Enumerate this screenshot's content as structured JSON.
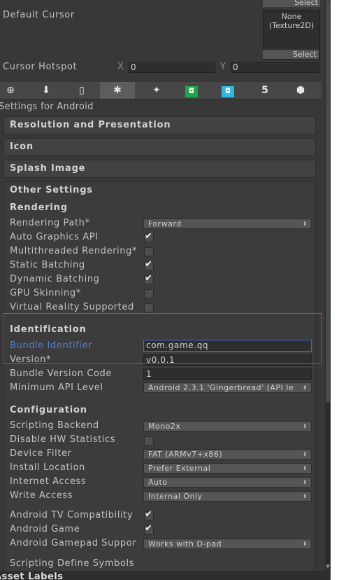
{
  "cursor": {
    "top_select": "Select",
    "default_label": "Default Cursor",
    "texture_text": "None\n(Texture2D)",
    "select": "Select",
    "hotspot_label": "Cursor Hotspot",
    "x_label": "X",
    "x_value": "0",
    "y_label": "Y",
    "y_value": "0"
  },
  "platform_tabs": [
    {
      "icon": "globe-icon",
      "glyph": "⊕"
    },
    {
      "icon": "download-icon",
      "glyph": "⬇"
    },
    {
      "icon": "phone-icon",
      "glyph": "▯"
    },
    {
      "icon": "android-icon",
      "glyph": "✱"
    },
    {
      "icon": "blackberry-icon",
      "glyph": "✦"
    },
    {
      "icon": "samsung-tv-icon",
      "glyph": "◘"
    },
    {
      "icon": "tizen-icon",
      "glyph": "◘"
    },
    {
      "icon": "html5-icon",
      "glyph": "5"
    },
    {
      "icon": "cube-icon",
      "glyph": "⬢"
    }
  ],
  "settings_for": "Settings for Android",
  "sections": {
    "resolution": "Resolution and Presentation",
    "icon": "Icon",
    "splash": "Splash Image",
    "other": "Other Settings"
  },
  "rendering": {
    "header": "Rendering",
    "rendering_path_label": "Rendering Path*",
    "rendering_path_value": "Forward",
    "auto_graphics_label": "Auto Graphics API",
    "multithreaded_label": "Multithreaded Rendering*",
    "static_batching_label": "Static Batching",
    "dynamic_batching_label": "Dynamic Batching",
    "gpu_skinning_label": "GPU Skinning*",
    "vr_label": "Virtual Reality Supported"
  },
  "identification": {
    "header": "Identification",
    "bundle_id_label": "Bundle Identifier",
    "bundle_id_value": "com.game.qq",
    "version_label": "Version*",
    "version_value": "v0.0.1",
    "bundle_code_label": "Bundle Version Code",
    "bundle_code_value": "1",
    "min_api_label": "Minimum API Level",
    "min_api_value": "Android 2.3.1 'Gingerbread' (API le"
  },
  "configuration": {
    "header": "Configuration",
    "scripting_backend_label": "Scripting Backend",
    "scripting_backend_value": "Mono2x",
    "disable_hw_label": "Disable HW Statistics",
    "device_filter_label": "Device Filter",
    "device_filter_value": "FAT (ARMv7+x86)",
    "install_location_label": "Install Location",
    "install_location_value": "Prefer External",
    "internet_access_label": "Internet Access",
    "internet_access_value": "Auto",
    "write_access_label": "Write Access",
    "write_access_value": "Internal Only",
    "android_tv_label": "Android TV Compatibility",
    "android_game_label": "Android Game",
    "gamepad_label": "Android Gamepad Suppor",
    "gamepad_value": "Works with D-pad",
    "define_symbols_label": "Scripting Define Symbols"
  },
  "asset_labels": "Asset Labels",
  "colors": {
    "panel": "#383838",
    "highlight_label": "#4d7fe6",
    "focus_border": "#3d6bd6",
    "annotation": "#d23a3a",
    "android_green": "#1aa84a",
    "tizen_cyan": "#2fb8e6"
  }
}
